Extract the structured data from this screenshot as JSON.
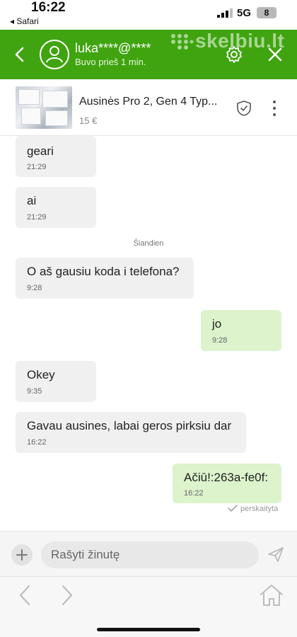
{
  "status_bar": {
    "time": "16:22",
    "back_app": "◂ Safari",
    "network": "5G",
    "battery": "8"
  },
  "header": {
    "contact_name": "luka****@****",
    "contact_status": "Buvo prieš 1 min.",
    "brand": "skelbiu.lt",
    "accent_color": "#3fa40f",
    "icons": [
      "chevron-left-icon",
      "user-avatar-icon",
      "gear-icon",
      "close-icon"
    ]
  },
  "product": {
    "title": "Ausinės Pro 2, Gen 4 Typ...",
    "price": "15 €",
    "icons": [
      "shield-check-icon",
      "more-vertical-icon"
    ]
  },
  "messages": [
    {
      "direction": "in",
      "text": "geari",
      "time": "21:29"
    },
    {
      "direction": "in",
      "text": "ai",
      "time": "21:29"
    },
    {
      "direction": "in",
      "text": "O aš gausiu koda i telefona?",
      "time": "9:28"
    },
    {
      "direction": "out",
      "text": "jo",
      "time": "9:28"
    },
    {
      "direction": "in",
      "text": "Okey",
      "time": "9:35"
    },
    {
      "direction": "in",
      "text": "Gavau ausines, labai geros pirksiu dar",
      "time": "16:22"
    },
    {
      "direction": "out",
      "text": "Ačiū!:263a-fe0f:",
      "time": "16:22"
    }
  ],
  "day_separator": "Šiandien",
  "read_receipt": "perskaityta",
  "composer": {
    "placeholder": "Rašyti žinutę",
    "icons": [
      "plus-icon",
      "send-icon"
    ]
  },
  "safari_bar": {
    "icons": [
      "back-arrow-icon",
      "forward-arrow-icon",
      "home-icon"
    ]
  }
}
